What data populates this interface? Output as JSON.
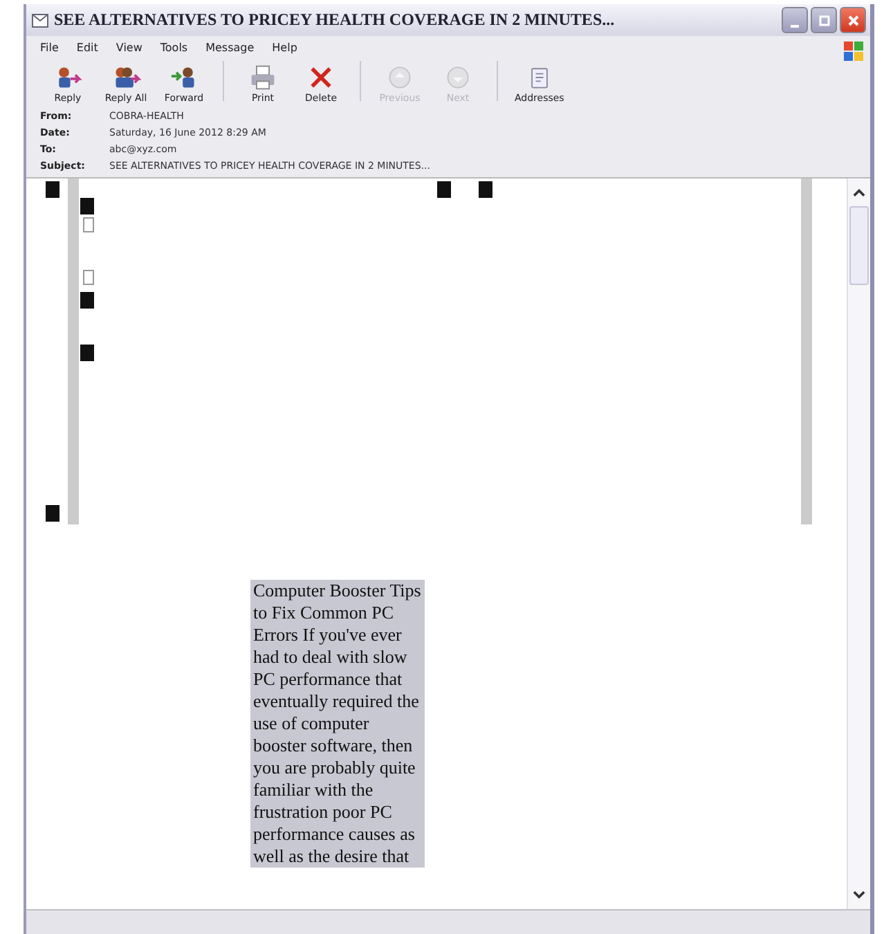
{
  "window": {
    "title": "SEE ALTERNATIVES TO PRICEY HEALTH COVERAGE IN 2 MINUTES..."
  },
  "menu": [
    "File",
    "Edit",
    "View",
    "Tools",
    "Message",
    "Help"
  ],
  "toolbar": [
    {
      "kind": "reply",
      "label": "Reply",
      "disabled": false
    },
    {
      "kind": "replyall",
      "label": "Reply All",
      "disabled": false
    },
    {
      "kind": "forward",
      "label": "Forward",
      "disabled": false
    },
    {
      "kind": "print",
      "label": "Print",
      "disabled": false
    },
    {
      "kind": "delete",
      "label": "Delete",
      "disabled": false
    },
    {
      "kind": "previous",
      "label": "Previous",
      "disabled": true
    },
    {
      "kind": "next",
      "label": "Next",
      "disabled": true
    },
    {
      "kind": "addresses",
      "label": "Addresses",
      "disabled": false
    }
  ],
  "headers": [
    {
      "label": "From:",
      "value": "COBRA-HEALTH"
    },
    {
      "label": "Date:",
      "value": "Saturday, 16 June 2012 8:29 AM"
    },
    {
      "label": "To:",
      "value": "abc@xyz.com"
    },
    {
      "label": "Subject:",
      "value": "SEE ALTERNATIVES TO PRICEY HEALTH COVERAGE IN 2 MINUTES..."
    }
  ],
  "message": {
    "body_text": "Computer Booster Tips to Fix Common PC Errors If you've ever had to deal with slow PC performance that eventually required the use of computer booster software, then you are probably quite familiar with the frustration poor PC performance causes as well as the desire that"
  }
}
